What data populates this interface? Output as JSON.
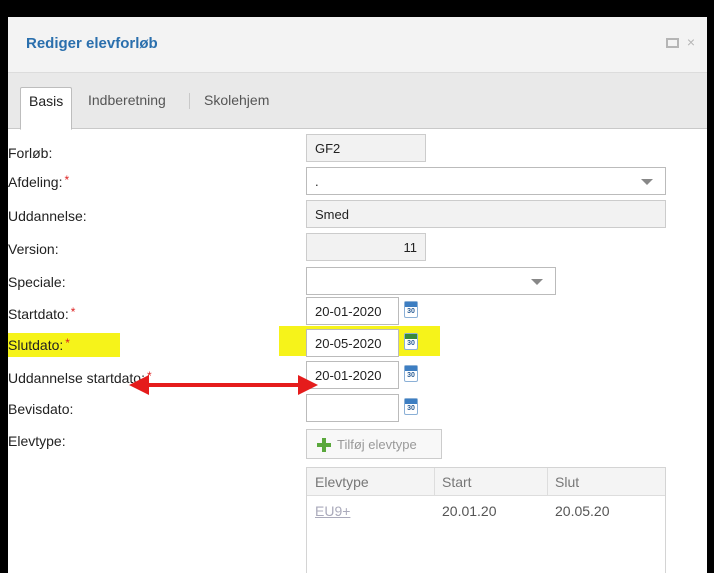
{
  "dialog": {
    "title": "Rediger elevforløb",
    "controls": {
      "maximize": "",
      "close": "×"
    }
  },
  "tabs": [
    {
      "label": "Basis",
      "active": true
    },
    {
      "label": "Indberetning",
      "active": false
    },
    {
      "label": "Skolehjem",
      "active": false
    }
  ],
  "form": {
    "forlob": {
      "label": "Forløb:",
      "value": "GF2"
    },
    "afdeling": {
      "label": "Afdeling:",
      "required": "*",
      "value": "."
    },
    "uddannelse": {
      "label": "Uddannelse:",
      "value": "Smed"
    },
    "version": {
      "label": "Version:",
      "value": "11"
    },
    "speciale": {
      "label": "Speciale:",
      "value": ""
    },
    "startdato": {
      "label": "Startdato:",
      "required": "*",
      "value": "20-01-2020"
    },
    "slutdato": {
      "label": "Slutdato:",
      "required": "*",
      "value": "20-05-2020"
    },
    "uddannelse_startdato": {
      "label": "Uddannelse startdato:",
      "required": "*",
      "value": "20-01-2020"
    },
    "bevisdato": {
      "label": "Bevisdato:",
      "value": ""
    },
    "elevtype": {
      "label": "Elevtype:",
      "add_button": "Tilføj elevtype"
    }
  },
  "calendar_icon_text": "30",
  "elevtype_grid": {
    "columns": [
      "Elevtype",
      "Start",
      "Slut"
    ],
    "rows": [
      {
        "elevtype": "EU9+",
        "start": "20.01.20",
        "slut": "20.05.20"
      }
    ]
  },
  "colors": {
    "title": "#2a6fad",
    "required": "#dd2222",
    "highlight": "#f6f31a",
    "arrow": "#e51c1c"
  }
}
